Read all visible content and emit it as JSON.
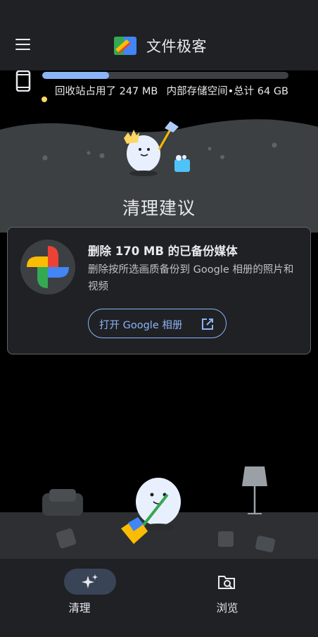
{
  "app": {
    "title": "文件极客"
  },
  "storage": {
    "trash_text": "回收站占用了 247 MB",
    "total_text": "内部存储空间•总计 64 GB",
    "usage_fraction": 0.27
  },
  "section": {
    "title": "清理建议"
  },
  "card": {
    "title": "删除 170 MB 的已备份媒体",
    "description": "删除按所选画质备份到 Google 相册的照片和视频",
    "button_label": "打开 Google 相册"
  },
  "nav": {
    "items": [
      {
        "label": "清理",
        "icon": "sparkle-icon",
        "selected": true
      },
      {
        "label": "浏览",
        "icon": "folder-search-icon",
        "selected": false
      }
    ]
  },
  "colors": {
    "accent": "#8ab4f8",
    "background": "#000000",
    "surface": "#202124",
    "trash_dot": "#fdd663"
  }
}
